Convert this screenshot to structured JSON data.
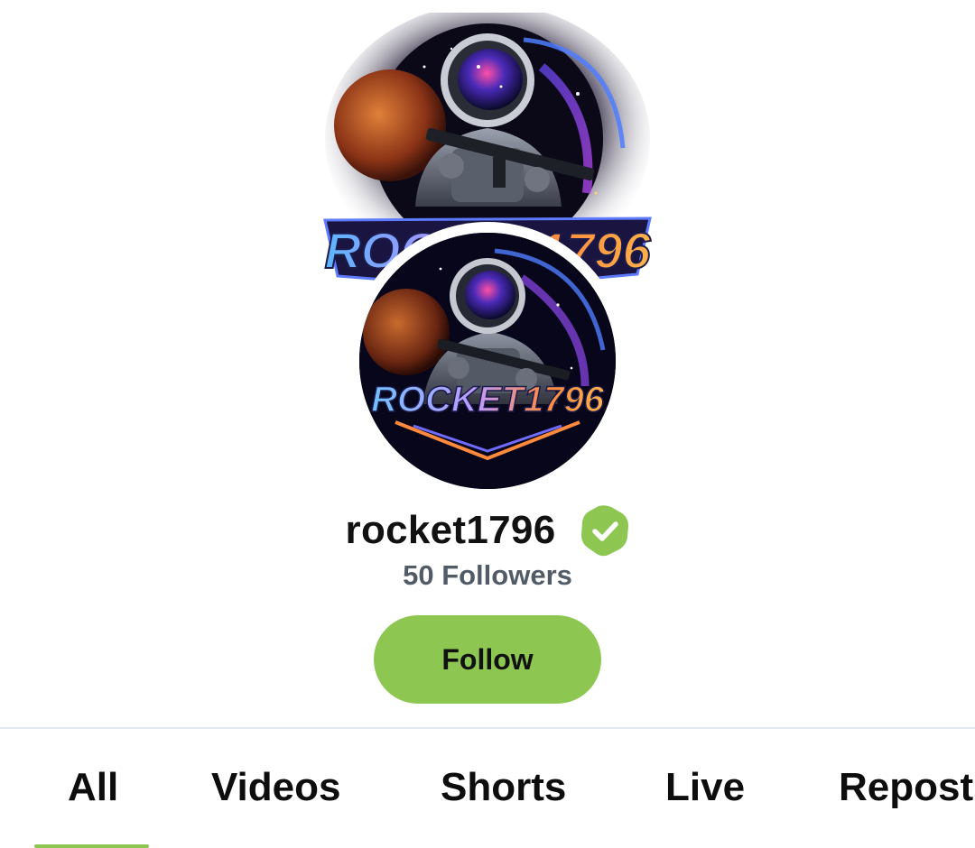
{
  "banner": {
    "logo_text": "ROCKET1796",
    "description_icon": "astronaut-banner-artwork"
  },
  "avatar": {
    "logo_text": "ROCKET1796",
    "description_icon": "astronaut-avatar"
  },
  "profile": {
    "username": "rocket1796",
    "verified_icon": "verified-check-icon",
    "followers": "50 Followers"
  },
  "actions": {
    "follow_label": "Follow"
  },
  "tabs": [
    {
      "label": "All",
      "active": true
    },
    {
      "label": "Videos",
      "active": false
    },
    {
      "label": "Shorts",
      "active": false
    },
    {
      "label": "Live",
      "active": false
    },
    {
      "label": "Reposts",
      "active": false
    }
  ],
  "colors": {
    "accent": "#8dc651",
    "text": "#111111",
    "muted": "#525c67",
    "divider": "#e3e9ec"
  }
}
